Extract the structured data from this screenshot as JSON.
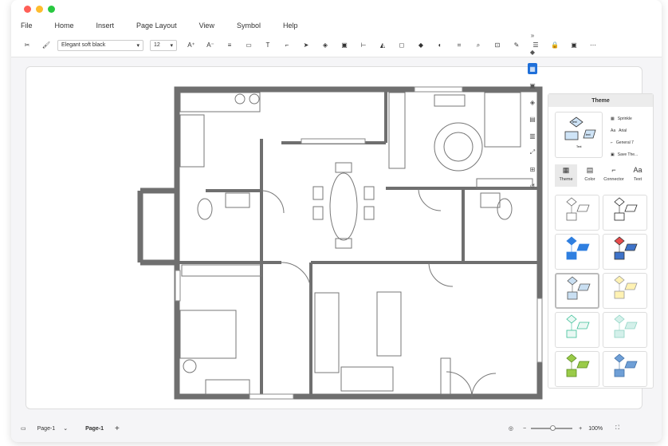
{
  "menu": [
    "File",
    "Home",
    "Insert",
    "Page Layout",
    "View",
    "Symbol",
    "Help"
  ],
  "toolbar": {
    "font": "Elegant soft black",
    "font_size": "12"
  },
  "panel": {
    "title": "Theme",
    "options": [
      "Sprinkle",
      "Arial",
      "General 7",
      "Save The..."
    ],
    "tabs": [
      "Theme",
      "Color",
      "Connector",
      "Text"
    ],
    "preview_labels": [
      "text",
      "text",
      "Text"
    ]
  },
  "status": {
    "page_select": "Page-1",
    "page_tab": "Page-1",
    "zoom": "100%"
  },
  "colors": {
    "accent": "#1e6fd9",
    "wall": "#6f6f6f"
  },
  "swatches": [
    {
      "fill1": "#ffffff",
      "fill2": "#ffffff",
      "stroke": "#666"
    },
    {
      "fill1": "#ffffff",
      "fill2": "#ffffff",
      "stroke": "#222"
    },
    {
      "fill1": "#2f7fe0",
      "fill2": "#2f7fe0",
      "stroke": "#2f7fe0"
    },
    {
      "fill1": "#e84b4b",
      "fill2": "#3e73c9",
      "stroke": "#333"
    },
    {
      "fill1": "#c9dff2",
      "fill2": "#c9dff2",
      "stroke": "#555"
    },
    {
      "fill1": "#fff2b3",
      "fill2": "#fff2b3",
      "stroke": "#999"
    },
    {
      "fill1": "#e9f8f3",
      "fill2": "#e9f8f3",
      "stroke": "#3bbf97"
    },
    {
      "fill1": "#d4f0ea",
      "fill2": "#d4f0ea",
      "stroke": "#8fd3c3"
    },
    {
      "fill1": "#9acb49",
      "fill2": "#9acb49",
      "stroke": "#5a8a1f"
    },
    {
      "fill1": "#6f9fd6",
      "fill2": "#6f9fd6",
      "stroke": "#3f6fa6"
    }
  ]
}
